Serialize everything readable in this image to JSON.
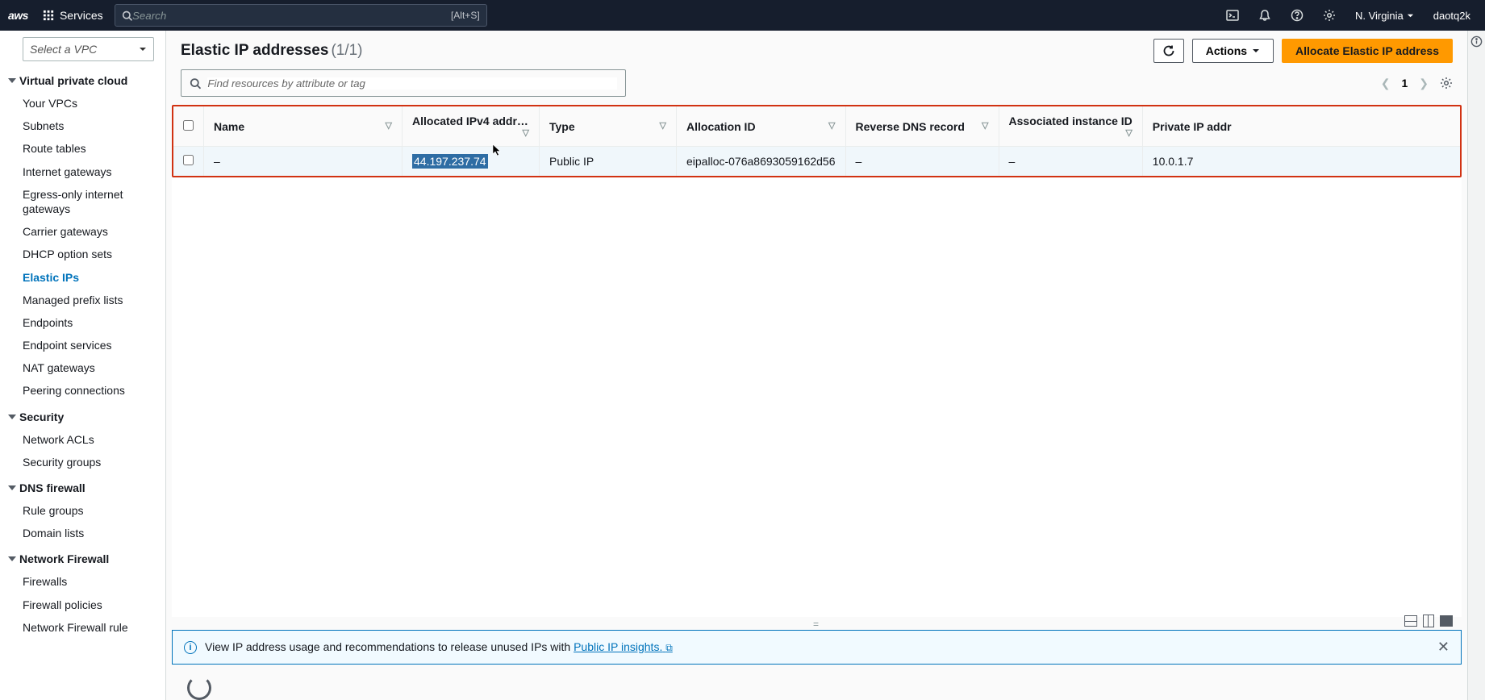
{
  "topbar": {
    "logo_text": "aws",
    "services_label": "Services",
    "search_placeholder": "Search",
    "search_shortcut": "[Alt+S]",
    "region": "N. Virginia",
    "username": "daotq2k"
  },
  "sidebar": {
    "vpc_select_placeholder": "Select a VPC",
    "groups": [
      {
        "title": "Virtual private cloud",
        "items": [
          {
            "label": "Your VPCs",
            "active": false
          },
          {
            "label": "Subnets",
            "active": false
          },
          {
            "label": "Route tables",
            "active": false
          },
          {
            "label": "Internet gateways",
            "active": false
          },
          {
            "label": "Egress-only internet gateways",
            "active": false
          },
          {
            "label": "Carrier gateways",
            "active": false
          },
          {
            "label": "DHCP option sets",
            "active": false
          },
          {
            "label": "Elastic IPs",
            "active": true
          },
          {
            "label": "Managed prefix lists",
            "active": false
          },
          {
            "label": "Endpoints",
            "active": false
          },
          {
            "label": "Endpoint services",
            "active": false
          },
          {
            "label": "NAT gateways",
            "active": false
          },
          {
            "label": "Peering connections",
            "active": false
          }
        ]
      },
      {
        "title": "Security",
        "items": [
          {
            "label": "Network ACLs",
            "active": false
          },
          {
            "label": "Security groups",
            "active": false
          }
        ]
      },
      {
        "title": "DNS firewall",
        "items": [
          {
            "label": "Rule groups",
            "active": false
          },
          {
            "label": "Domain lists",
            "active": false
          }
        ]
      },
      {
        "title": "Network Firewall",
        "items": [
          {
            "label": "Firewalls",
            "active": false
          },
          {
            "label": "Firewall policies",
            "active": false
          },
          {
            "label": "Network Firewall rule",
            "active": false
          }
        ]
      }
    ]
  },
  "main": {
    "title": "Elastic IP addresses",
    "count": "(1/1)",
    "refresh_label": "",
    "actions_label": "Actions",
    "allocate_label": "Allocate Elastic IP address",
    "filter_placeholder": "Find resources by attribute or tag",
    "page_current": "1",
    "columns": {
      "name": "Name",
      "allocated_ip": "Allocated IPv4 addr…",
      "type": "Type",
      "allocation_id": "Allocation ID",
      "reverse_dns": "Reverse DNS record",
      "assoc_instance": "Associated instance ID",
      "private_ip": "Private IP addr"
    },
    "rows": [
      {
        "name": "–",
        "allocated_ip": "44.197.237.74",
        "type": "Public IP",
        "allocation_id": "eipalloc-076a8693059162d56",
        "reverse_dns": "–",
        "assoc_instance": "–",
        "private_ip": "10.0.1.7"
      }
    ],
    "banner": {
      "text": "View IP address usage and recommendations to release unused IPs with ",
      "link": "Public IP insights."
    }
  }
}
